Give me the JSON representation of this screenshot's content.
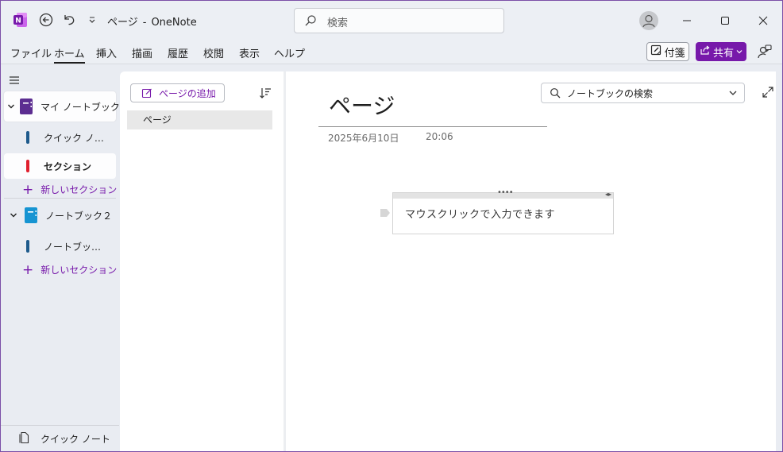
{
  "titlebar": {
    "page_name": "ページ",
    "separator": "-",
    "app_name": "OneNote",
    "search_placeholder": "検索"
  },
  "menu": {
    "items": [
      "ファイル",
      "ホーム",
      "挿入",
      "描画",
      "履歴",
      "校閲",
      "表示",
      "ヘルプ"
    ],
    "active": "ホーム",
    "sticky_notes": "付箋",
    "share": "共有"
  },
  "notebooks": [
    {
      "name": "マイ ノートブック",
      "color": "#5c2d91",
      "sections": [
        {
          "label": "クイック ノ…",
          "color": "#1e5a8c",
          "selected": false
        },
        {
          "label": "セクション",
          "color": "#e0202e",
          "selected": true
        }
      ],
      "add_section": "新しいセクション"
    },
    {
      "name": "ノートブック２",
      "color": "#1694d2",
      "sections": [
        {
          "label": "ノートブッ…",
          "color": "#1e5a8c",
          "selected": false
        }
      ],
      "add_section": "新しいセクション"
    }
  ],
  "quick_notes_label": "クイック ノート",
  "pages_pane": {
    "add_page": "ページの追加",
    "pages": [
      "ページ"
    ]
  },
  "canvas": {
    "notebook_search_placeholder": "ノートブックの検索",
    "page_title": "ページ",
    "date": "2025年6月10日",
    "time": "20:06",
    "note_text": "マウスクリックで入力できます"
  },
  "colors": {
    "accent": "#7719aa",
    "window_border": "#7b4fa7",
    "onenote_logo": "#7719aa"
  },
  "icons": {
    "app": "onenote-logo-icon",
    "back": "back-arrow-icon",
    "undo": "undo-icon",
    "customize": "chevron-down-icon",
    "search": "search-icon",
    "user": "user-avatar-icon",
    "minimize": "minimize-icon",
    "maximize": "maximize-icon",
    "close": "close-icon",
    "sticky": "sticky-note-icon",
    "share": "share-icon",
    "feedback": "feedback-icon",
    "nav_menu": "hamburger-icon",
    "add_page": "edit-icon",
    "sort": "sort-icon",
    "expand": "expand-icon"
  }
}
